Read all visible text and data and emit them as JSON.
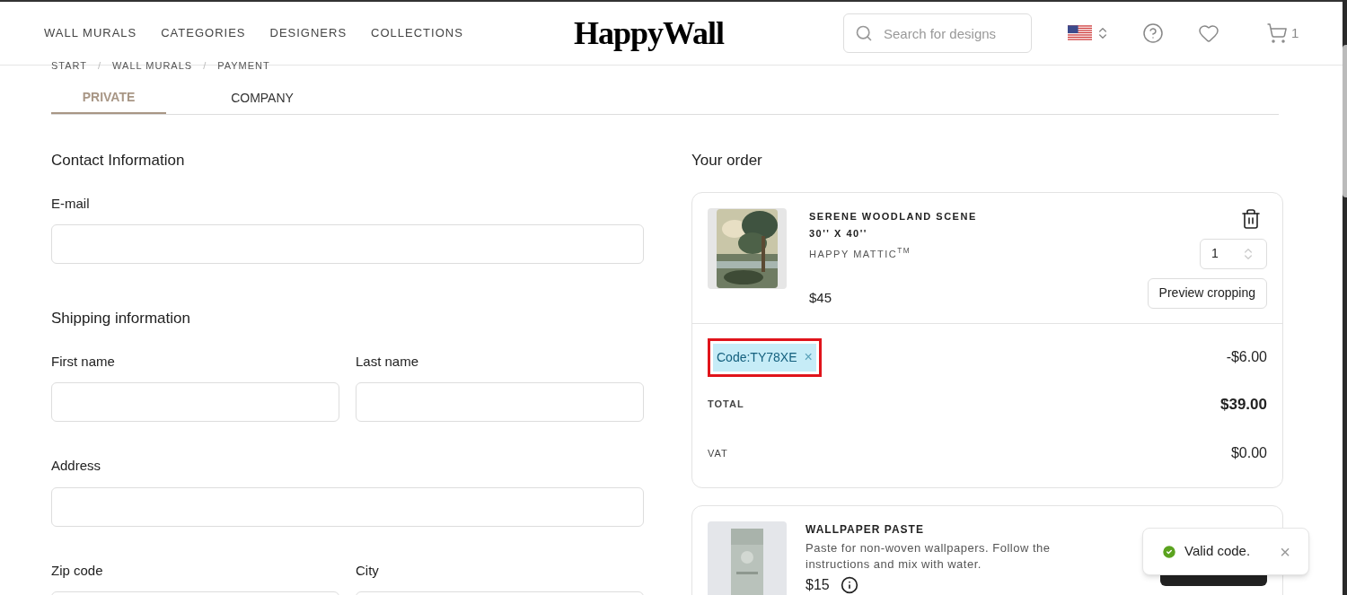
{
  "header": {
    "nav": [
      "WALL MURALS",
      "CATEGORIES",
      "DESIGNERS",
      "COLLECTIONS"
    ],
    "logo": "HappyWall",
    "search": {
      "placeholder": "Search for designs"
    },
    "cart_count": "1"
  },
  "breadcrumb": {
    "items": [
      "START",
      "WALL MURALS",
      "PAYMENT"
    ],
    "separator": "/"
  },
  "tabs": [
    {
      "label": "PRIVATE",
      "selected": true
    },
    {
      "label": "COMPANY",
      "selected": false
    }
  ],
  "contact": {
    "title": "Contact Information",
    "fields": [
      {
        "label": "E-mail"
      }
    ]
  },
  "shipping": {
    "title": "Shipping information",
    "rows": [
      [
        {
          "label": "First name"
        },
        {
          "label": "Last name"
        }
      ],
      [
        {
          "label": "Address"
        }
      ],
      [
        {
          "label": "Zip code"
        },
        {
          "label": "City"
        }
      ]
    ]
  },
  "order": {
    "title": "Your order",
    "item": {
      "name": "SERENE WOODLAND SCENE",
      "size": "30'' X 40''",
      "material": "HAPPY MATTIC$^{TM}$",
      "price": "$45",
      "quantity": "1",
      "preview_button": "Preview cropping"
    },
    "discount": {
      "code": "Code:TY78XE",
      "remove": "×",
      "amount": "-$6.00",
      "highlighted": true
    },
    "totals": [
      {
        "label": "TOTAL",
        "value": "$39.00",
        "kind": "total"
      },
      {
        "label": "VAT",
        "value": "$0.00",
        "kind": "vat"
      }
    ]
  },
  "addon": {
    "name": "WALLPAPER PASTE",
    "description": "Paste for non-woven wallpapers. Follow the instructions and mix with water.",
    "price": "$15"
  },
  "toast": {
    "message": "Valid code.",
    "close": "×"
  }
}
